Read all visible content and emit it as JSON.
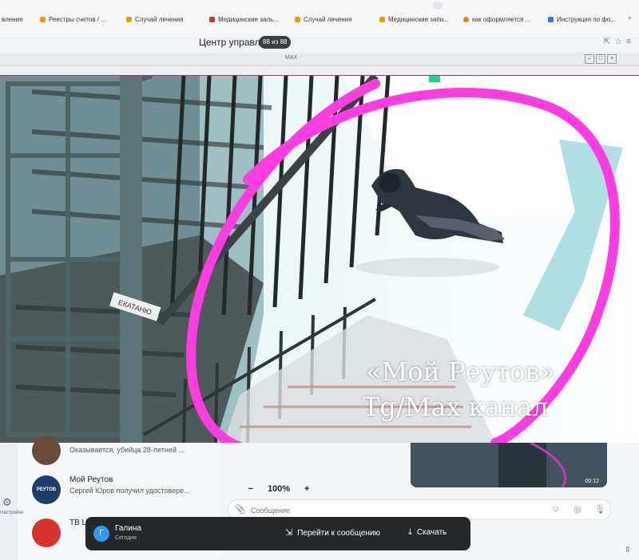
{
  "browser": {
    "bookmarks": [
      {
        "label": "вления",
        "color": "#ffffff"
      },
      {
        "label": "Реестры счетов / ...",
        "color": "#e0a000"
      },
      {
        "label": "Случай лечения",
        "color": "#e0a000"
      },
      {
        "label": "Медицинские заль...",
        "color": "#c0392b"
      },
      {
        "label": "Случай лечения",
        "color": "#e0a000"
      },
      {
        "label": "Медицинские запи...",
        "color": "#e0a000"
      },
      {
        "label": "как оформляется ...",
        "color": "#e67e22"
      },
      {
        "label": "Инструкция по фо...",
        "color": "#2d7be5"
      }
    ]
  },
  "app": {
    "title": "Центр управлен",
    "page_indicator": "88 из 88",
    "window_title": "MAX"
  },
  "photo": {
    "watermark_line1": "«Мой Реутов»",
    "watermark_line2": "Tg/Max канал",
    "sticker_text": "ЕКАТАНЮ"
  },
  "chats": [
    {
      "name": "",
      "preview": "Оказывается, убийца 28-летней ...",
      "avatar_color": "#6a4b3a"
    },
    {
      "name": "Мой Реутов",
      "preview": "Сергей Юров получил удостовере...",
      "avatar_color": "#1d3d6b",
      "avatar_text": "РЕУТОВ"
    },
    {
      "name": "ТВ ЦЕНТР",
      "preview": "",
      "avatar_color": "#d6332a"
    }
  ],
  "sidebar": {
    "settings_label": "Настройки"
  },
  "media": {
    "duration": "00:12"
  },
  "zoom": {
    "minus": "−",
    "value": "100%",
    "plus": "+"
  },
  "composer": {
    "placeholder": "Сообщение"
  },
  "viewer": {
    "sender_initial": "Г",
    "sender_name": "Галина",
    "sender_time": "Сегодня",
    "goto_label": "Перейти к сообщению",
    "download_label": "Скачать"
  },
  "colors": {
    "accent": "#2f9bf0",
    "annotation": "#ff3ce0",
    "toolbar": "#26272b"
  }
}
